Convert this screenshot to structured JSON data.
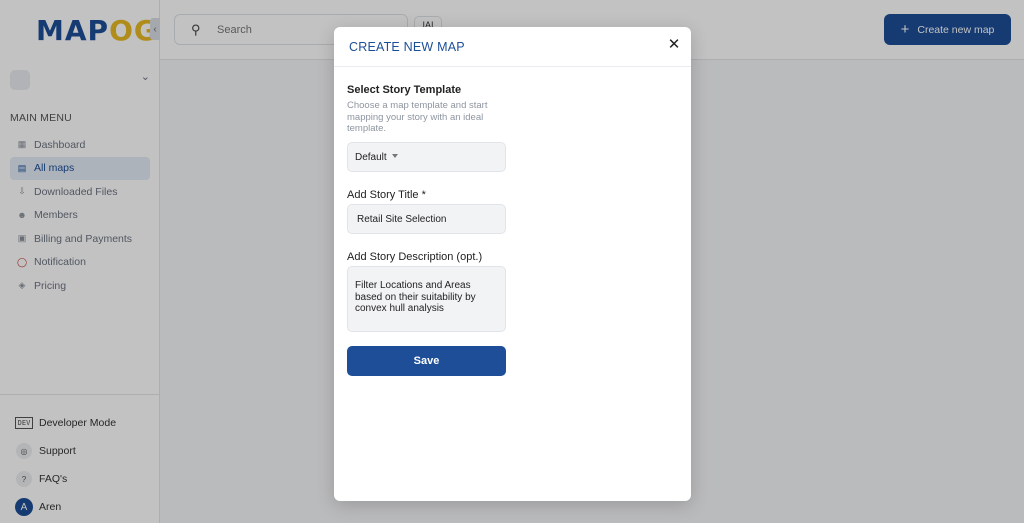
{
  "logo": {
    "part1": "MAP",
    "part2": "OG"
  },
  "sidebar": {
    "menu_title": "MAIN MENU",
    "items": [
      {
        "label": "Dashboard",
        "icon": "grid-icon",
        "active": false
      },
      {
        "label": "All maps",
        "icon": "layers-icon",
        "active": true
      },
      {
        "label": "Downloaded Files",
        "icon": "download-icon",
        "active": false
      },
      {
        "label": "Members",
        "icon": "user-icon",
        "active": false
      },
      {
        "label": "Billing and Payments",
        "icon": "card-icon",
        "active": false
      },
      {
        "label": "Notification",
        "icon": "bell-icon",
        "active": false
      },
      {
        "label": "Pricing",
        "icon": "tag-icon",
        "active": false
      }
    ],
    "bottom": {
      "developer_mode": "Developer Mode",
      "dev_badge": "DEV",
      "support": "Support",
      "faqs": "FAQ's",
      "user_name": "Aren",
      "user_initial": "A"
    }
  },
  "header": {
    "search_placeholder": "Search",
    "workspace_chip": "IAI",
    "create_button": "Create new map"
  },
  "modal": {
    "title": "CREATE NEW MAP",
    "template_label": "Select Story Template",
    "template_help": "Choose a map template and start mapping your story with an ideal template.",
    "template_value": "Default",
    "title_label": "Add Story Title *",
    "title_value": "Retail Site Selection",
    "description_label": "Add Story Description (opt.)",
    "description_value": "Filter Locations and Areas based on their suitability by convex hull analysis",
    "save_button": "Save"
  },
  "colors": {
    "brand_blue": "#1d4e97",
    "logo_gold": "#e8b923",
    "overlay": "rgba(0,0,0,0.24)"
  }
}
